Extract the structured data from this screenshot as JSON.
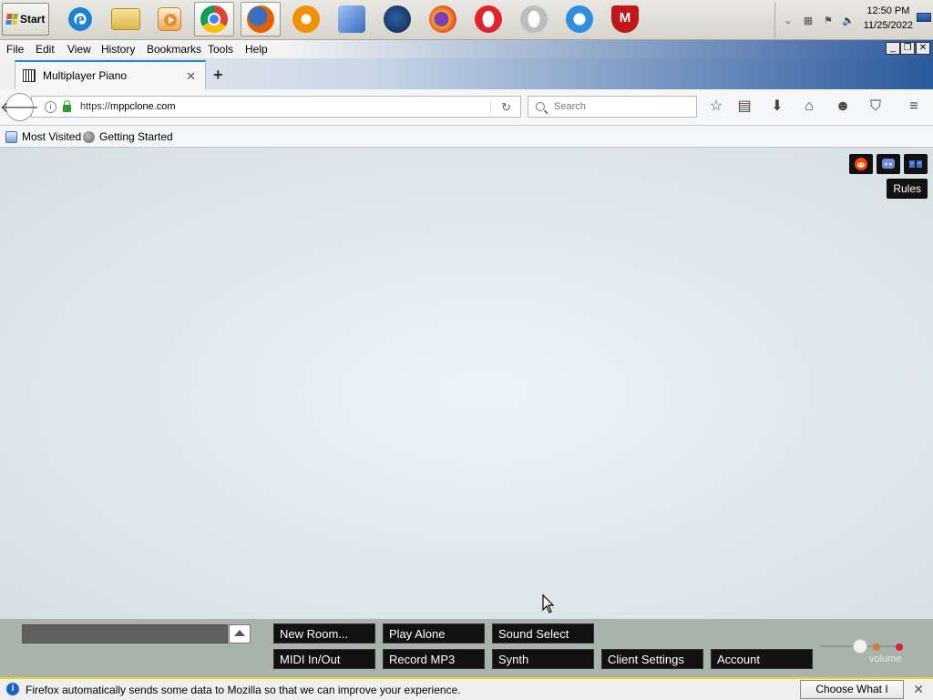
{
  "taskbar": {
    "start_label": "Start",
    "apps": [
      {
        "name": "internet-explorer-icon",
        "color": "#1e7fd6"
      },
      {
        "name": "file-explorer-icon",
        "color": "#e6c35a"
      },
      {
        "name": "media-player-icon",
        "color": "#f08a2a"
      },
      {
        "name": "chrome-icon",
        "color": "#db4437"
      },
      {
        "name": "firefox-icon",
        "color": "#e66000"
      },
      {
        "name": "avast-icon",
        "color": "#f29100"
      },
      {
        "name": "network-tool-icon",
        "color": "#3a6cc4"
      },
      {
        "name": "waterfox-icon",
        "color": "#1a3b6b"
      },
      {
        "name": "firefox-nightly-icon",
        "color": "#e8462c"
      },
      {
        "name": "opera-icon",
        "color": "#e0232e"
      },
      {
        "name": "opera-gray-icon",
        "color": "#bdbdbd"
      },
      {
        "name": "quicktime-icon",
        "color": "#2c8fe0"
      },
      {
        "name": "mcafee-icon",
        "color": "#c01818"
      }
    ],
    "clock_time": "12:50 PM",
    "clock_date": "11/25/2022"
  },
  "menubar": {
    "items": [
      "File",
      "Edit",
      "View",
      "History",
      "Bookmarks",
      "Tools",
      "Help"
    ]
  },
  "tab": {
    "title": "Multiplayer Piano",
    "close_glyph": "✕",
    "new_tab_glyph": "+"
  },
  "navbar": {
    "url_scheme": "https://",
    "url_host": "mppclone.com",
    "search_placeholder": "Search"
  },
  "bookmarks": {
    "items": [
      "Most Visited",
      "Getting Started"
    ]
  },
  "page": {
    "corner_buttons": [
      {
        "name": "reddit-icon",
        "color": "#ff4500"
      },
      {
        "name": "discord-icon",
        "color": "#7289da"
      },
      {
        "name": "rules-icon",
        "color": "#3b6fd6"
      }
    ],
    "tooltip": "Rules"
  },
  "controls": {
    "row1": [
      "New Room...",
      "Play Alone",
      "Sound Select"
    ],
    "row2": [
      "MIDI In/Out",
      "Record MP3",
      "Synth",
      "Client Settings",
      "Account"
    ],
    "volume_label": "volume"
  },
  "notification": {
    "text": "Firefox automatically sends some data to Mozilla so that we can improve your experience.",
    "button": "Choose What I Share"
  }
}
